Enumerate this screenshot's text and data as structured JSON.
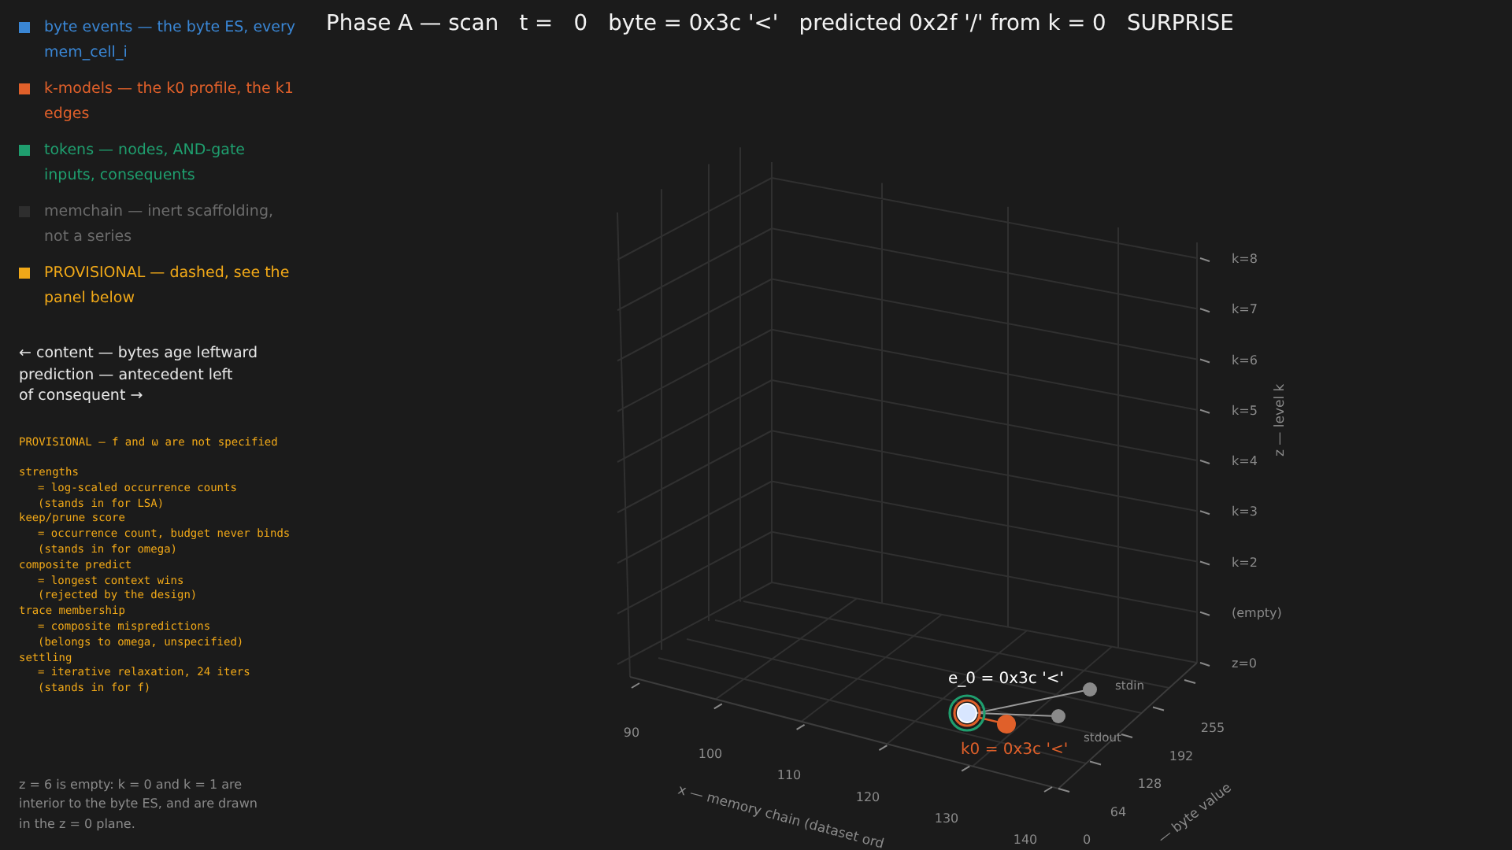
{
  "title": "Phase A — scan   t =   0   byte = 0x3c '<'   predicted 0x2f '/' from k = 0   SURPRISE",
  "legend": [
    {
      "label": "byte events — the byte ES, every mem_cell_i",
      "color": "#3a86d4"
    },
    {
      "label": "k-models — the k0 profile, the k1 edges",
      "color": "#e0602a"
    },
    {
      "label": "tokens — nodes, AND-gate inputs, consequents",
      "color": "#1f9e6e"
    },
    {
      "label": "memchain — inert scaffolding, not a series",
      "color": "#2e2e2e"
    },
    {
      "label": "PROVISIONAL — dashed, see the panel below",
      "color": "#f0a818"
    }
  ],
  "direction_note": "←  content — bytes age leftward\nprediction — antecedent left\nof consequent  →",
  "provisional_panel": {
    "heading": "PROVISIONAL — f and ω are not specified",
    "entries": [
      {
        "term": "strengths",
        "definition": "= log-scaled occurrence counts",
        "note": "(stands in for LSA)"
      },
      {
        "term": "keep/prune score",
        "definition": "= occurrence count, budget never binds",
        "note": "(stands in for omega)"
      },
      {
        "term": "composite predict",
        "definition": "= longest context wins",
        "note": "(rejected by the design)"
      },
      {
        "term": "trace membership",
        "definition": "= composite mispredictions",
        "note": "(belongs to omega, unspecified)"
      },
      {
        "term": "settling",
        "definition": "= iterative relaxation, 24 iters",
        "note": "(stands in for f)"
      }
    ]
  },
  "footnote": "z = 6 is empty: k = 0 and k = 1 are interior to the byte ES, and are drawn in the z = 0 plane.",
  "plot": {
    "z_title": "z — level k",
    "z_ticks": [
      "k=8",
      "k=7",
      "k=6",
      "k=5",
      "k=4",
      "k=3",
      "k=2",
      "(empty)",
      "z=0"
    ],
    "x_title": "x — memory chain (dataset ord",
    "x_ticks": [
      "90",
      "100",
      "110",
      "120",
      "130",
      "140"
    ],
    "y_title": "— byte value",
    "y_ticks": [
      "255",
      "192",
      "128",
      "64",
      "0"
    ],
    "points": [
      {
        "label": "e_0 = 0x3c '<'",
        "kind": "event"
      },
      {
        "label": "k0 = 0x3c '<'",
        "kind": "kmodel"
      },
      {
        "label": "stdin",
        "kind": "io"
      },
      {
        "label": "stdout",
        "kind": "io"
      }
    ]
  }
}
